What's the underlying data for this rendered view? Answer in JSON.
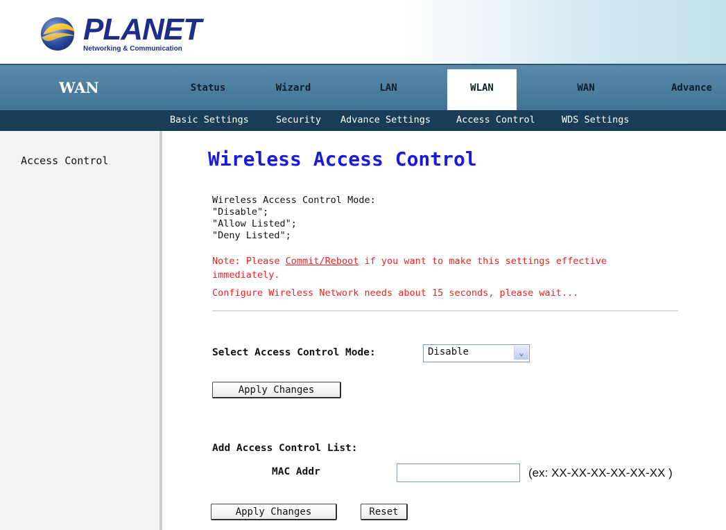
{
  "brand": {
    "name": "PLANET",
    "tagline": "Networking & Communication"
  },
  "nav": {
    "section_title": "WAN",
    "tabs": [
      {
        "label": "Status"
      },
      {
        "label": "Wizard"
      },
      {
        "label": "LAN"
      },
      {
        "label": "WLAN",
        "active": true
      },
      {
        "label": "WAN"
      },
      {
        "label": "Advance"
      }
    ],
    "subtabs": [
      {
        "label": "Basic Settings"
      },
      {
        "label": "Security"
      },
      {
        "label": "Advance Settings"
      },
      {
        "label": "Access Control",
        "active": true
      },
      {
        "label": "WDS Settings"
      }
    ]
  },
  "sidebar": {
    "items": [
      {
        "label": "Access Control"
      }
    ]
  },
  "main": {
    "title": "Wireless Access Control",
    "description": {
      "mode_heading": "Wireless Access Control Mode:",
      "options": [
        "\"Disable\";",
        "\"Allow Listed\";",
        "\"Deny Listed\";"
      ],
      "note_prefix": "Note: Please ",
      "note_link": "Commit/Reboot",
      "note_suffix": " if you want to make this settings effective",
      "note_line2": "immediately.",
      "configure_note": "Configure Wireless Network needs about 15 seconds, please wait..."
    },
    "mode": {
      "label": "Select Access Control Mode:",
      "selected": "Disable",
      "apply_label": "Apply Changes"
    },
    "acl": {
      "heading": "Add Access Control List:",
      "mac_label": "MAC Addr",
      "mac_value": "",
      "mac_example": "(ex: XX-XX-XX-XX-XX-XX )",
      "apply_label": "Apply Changes",
      "reset_label": "Reset"
    }
  }
}
